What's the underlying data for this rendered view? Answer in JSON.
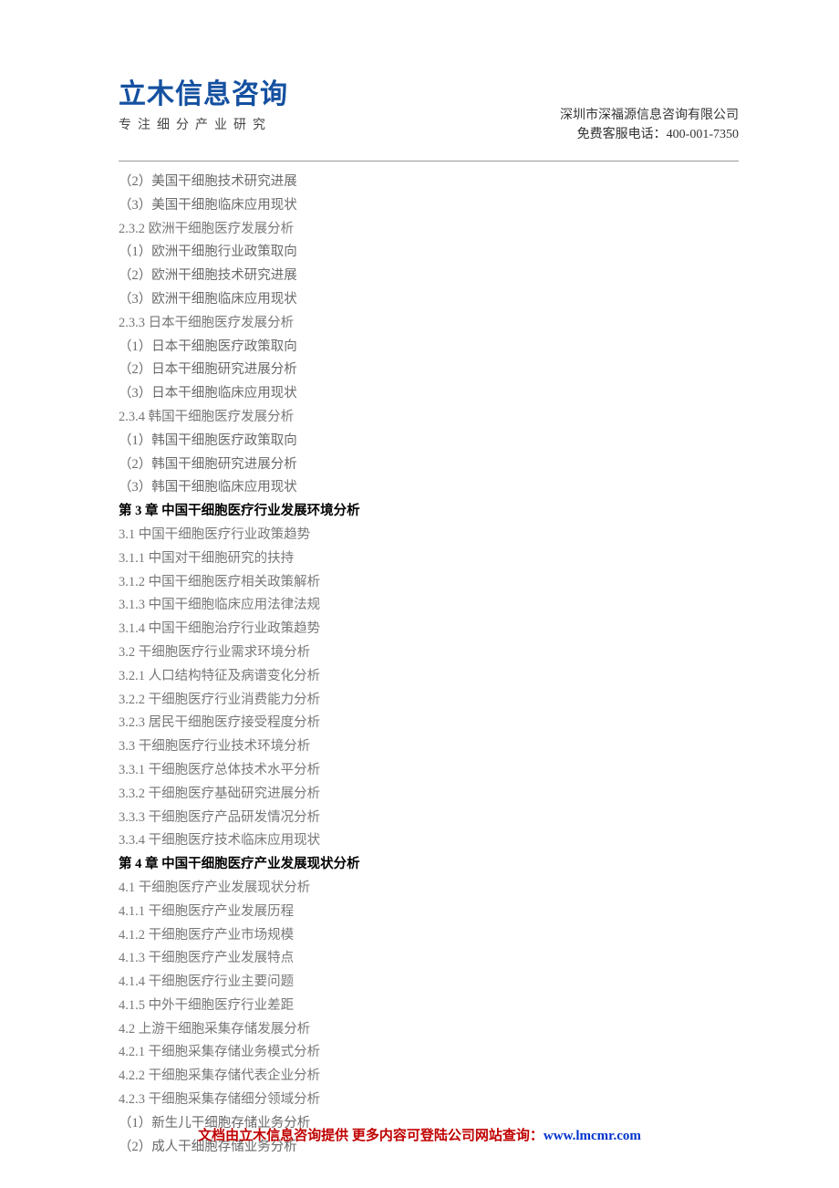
{
  "header": {
    "logo_main": "立木信息咨询",
    "logo_sub": "专注细分产业研究",
    "company": "深圳市深福源信息咨询有限公司",
    "phone_label": "免费客服电话：",
    "phone": "400-001-7350"
  },
  "toc": [
    {
      "text": "（2）美国干细胞技术研究进展",
      "type": "sub"
    },
    {
      "text": "（3）美国干细胞临床应用现状",
      "type": "sub"
    },
    {
      "text": "2.3.2 欧洲干细胞医疗发展分析",
      "type": "item"
    },
    {
      "text": "（1）欧洲干细胞行业政策取向",
      "type": "sub"
    },
    {
      "text": "（2）欧洲干细胞技术研究进展",
      "type": "sub"
    },
    {
      "text": "（3）欧洲干细胞临床应用现状",
      "type": "sub"
    },
    {
      "text": "2.3.3 日本干细胞医疗发展分析",
      "type": "item"
    },
    {
      "text": "（1）日本干细胞医疗政策取向",
      "type": "sub"
    },
    {
      "text": "（2）日本干细胞研究进展分析",
      "type": "sub"
    },
    {
      "text": "（3）日本干细胞临床应用现状",
      "type": "sub"
    },
    {
      "text": "2.3.4 韩国干细胞医疗发展分析",
      "type": "item"
    },
    {
      "text": "（1）韩国干细胞医疗政策取向",
      "type": "sub"
    },
    {
      "text": "（2）韩国干细胞研究进展分析",
      "type": "sub"
    },
    {
      "text": "（3）韩国干细胞临床应用现状",
      "type": "sub"
    },
    {
      "text": "第 3 章  中国干细胞医疗行业发展环境分析",
      "type": "chapter"
    },
    {
      "text": "3.1 中国干细胞医疗行业政策趋势",
      "type": "item"
    },
    {
      "text": "3.1.1 中国对干细胞研究的扶持",
      "type": "item"
    },
    {
      "text": "3.1.2 中国干细胞医疗相关政策解析",
      "type": "item"
    },
    {
      "text": "3.1.3 中国干细胞临床应用法律法规",
      "type": "item"
    },
    {
      "text": "3.1.4 中国干细胞治疗行业政策趋势",
      "type": "item"
    },
    {
      "text": "3.2 干细胞医疗行业需求环境分析",
      "type": "item"
    },
    {
      "text": "3.2.1 人口结构特征及病谱变化分析",
      "type": "item"
    },
    {
      "text": "3.2.2 干细胞医疗行业消费能力分析",
      "type": "item"
    },
    {
      "text": "3.2.3 居民干细胞医疗接受程度分析",
      "type": "item"
    },
    {
      "text": "3.3 干细胞医疗行业技术环境分析",
      "type": "item"
    },
    {
      "text": "3.3.1 干细胞医疗总体技术水平分析",
      "type": "item"
    },
    {
      "text": "3.3.2 干细胞医疗基础研究进展分析",
      "type": "item"
    },
    {
      "text": "3.3.3 干细胞医疗产品研发情况分析",
      "type": "item"
    },
    {
      "text": "3.3.4 干细胞医疗技术临床应用现状",
      "type": "item"
    },
    {
      "text": "第 4 章  中国干细胞医疗产业发展现状分析",
      "type": "chapter"
    },
    {
      "text": "4.1 干细胞医疗产业发展现状分析",
      "type": "item"
    },
    {
      "text": "4.1.1 干细胞医疗产业发展历程",
      "type": "item"
    },
    {
      "text": "4.1.2 干细胞医疗产业市场规模",
      "type": "item"
    },
    {
      "text": "4.1.3 干细胞医疗产业发展特点",
      "type": "item"
    },
    {
      "text": "4.1.4 干细胞医疗行业主要问题",
      "type": "item"
    },
    {
      "text": "4.1.5 中外干细胞医疗行业差距",
      "type": "item"
    },
    {
      "text": "4.2 上游干细胞采集存储发展分析",
      "type": "item"
    },
    {
      "text": "4.2.1 干细胞采集存储业务模式分析",
      "type": "item"
    },
    {
      "text": "4.2.2 干细胞采集存储代表企业分析",
      "type": "item"
    },
    {
      "text": "4.2.3 干细胞采集存储细分领域分析",
      "type": "item"
    },
    {
      "text": "（1）新生儿干细胞存储业务分析",
      "type": "sub"
    },
    {
      "text": "（2）成人干细胞存储业务分析",
      "type": "sub"
    }
  ],
  "footer": {
    "text_red": "文档由立木信息咨询提供  更多内容可登陆公司网站查询：",
    "link": "www.lmcmr.com"
  }
}
